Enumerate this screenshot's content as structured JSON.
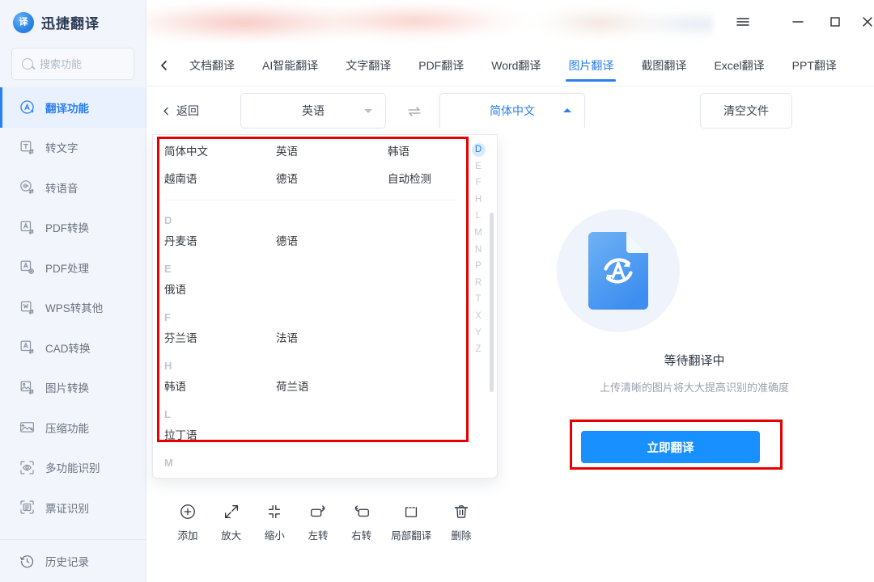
{
  "app": {
    "brand_title": "迅捷翻译",
    "brand_icon": "translate-logo-icon"
  },
  "titlebar": {
    "menu_icon": "hamburger-menu-icon",
    "minimize_icon": "minimize-icon",
    "maximize_icon": "maximize-icon",
    "close_icon": "close-icon"
  },
  "search": {
    "placeholder": "搜索功能",
    "value": "",
    "icon": "search-icon"
  },
  "sidebar": {
    "items": [
      {
        "label": "翻译功能",
        "icon": "translate-circle-icon",
        "active": true
      },
      {
        "label": "转文字",
        "icon": "to-text-icon",
        "active": false
      },
      {
        "label": "转语音",
        "icon": "to-speech-icon",
        "active": false
      },
      {
        "label": "PDF转换",
        "icon": "pdf-convert-icon",
        "active": false
      },
      {
        "label": "PDF处理",
        "icon": "pdf-process-icon",
        "active": false
      },
      {
        "label": "WPS转其他",
        "icon": "wps-convert-icon",
        "active": false
      },
      {
        "label": "CAD转换",
        "icon": "cad-convert-icon",
        "active": false
      },
      {
        "label": "图片转换",
        "icon": "image-convert-icon",
        "active": false
      },
      {
        "label": "压缩功能",
        "icon": "compress-icon",
        "active": false
      },
      {
        "label": "多功能识别",
        "icon": "multi-recognize-icon",
        "active": false
      },
      {
        "label": "票证识别",
        "icon": "ticket-recognize-icon",
        "active": false
      }
    ],
    "history": {
      "label": "历史记录",
      "icon": "history-icon"
    }
  },
  "tabs": {
    "back_icon": "chevron-left-icon",
    "items": [
      {
        "label": "文档翻译",
        "active": false
      },
      {
        "label": "AI智能翻译",
        "active": false
      },
      {
        "label": "文字翻译",
        "active": false
      },
      {
        "label": "PDF翻译",
        "active": false
      },
      {
        "label": "Word翻译",
        "active": false
      },
      {
        "label": "图片翻译",
        "active": true
      },
      {
        "label": "截图翻译",
        "active": false
      },
      {
        "label": "Excel翻译",
        "active": false
      },
      {
        "label": "PPT翻译",
        "active": false
      }
    ]
  },
  "langbar": {
    "return_label": "返回",
    "return_icon": "chevron-left-icon",
    "source_language": "英语",
    "source_caret_icon": "chevron-down-icon",
    "swap_icon": "swap-arrows-icon",
    "target_language": "简体中文",
    "target_caret_icon": "chevron-up-icon",
    "clear_label": "清空文件"
  },
  "lang_panel": {
    "recent": [
      "简体中文",
      "英语",
      "韩语",
      "越南语",
      "德语",
      "自动检测"
    ],
    "sections": [
      {
        "letter": "D",
        "languages": [
          "丹麦语",
          "德语"
        ]
      },
      {
        "letter": "E",
        "languages": [
          "俄语"
        ]
      },
      {
        "letter": "F",
        "languages": [
          "芬兰语",
          "法语"
        ]
      },
      {
        "letter": "H",
        "languages": [
          "韩语",
          "荷兰语"
        ]
      },
      {
        "letter": "L",
        "languages": [
          "拉丁语"
        ]
      },
      {
        "letter": "M",
        "languages": []
      }
    ],
    "alphabet": [
      "D",
      "E",
      "F",
      "H",
      "L",
      "M",
      "N",
      "P",
      "R",
      "T",
      "X",
      "Y",
      "Z"
    ],
    "alphabet_active": "D"
  },
  "toolbar": {
    "items": [
      {
        "label": "添加",
        "icon": "plus-circle-icon"
      },
      {
        "label": "放大",
        "icon": "zoom-in-expand-icon"
      },
      {
        "label": "缩小",
        "icon": "zoom-out-collapse-icon"
      },
      {
        "label": "左转",
        "icon": "rotate-left-icon"
      },
      {
        "label": "右转",
        "icon": "rotate-right-icon"
      },
      {
        "label": "局部翻译",
        "icon": "partial-translate-icon"
      },
      {
        "label": "删除",
        "icon": "trash-icon"
      }
    ]
  },
  "right_panel": {
    "illustration_icon": "document-translate-icon",
    "status_title": "等待翻译中",
    "status_subtitle": "上传清晰的图片将大大提高识别的准确度",
    "translate_button": "立即翻译"
  },
  "colors": {
    "accent": "#2a7ff0",
    "button_blue": "#1890ff",
    "highlight_red": "#e60000",
    "sidebar_bg": "#f2f5fb"
  }
}
